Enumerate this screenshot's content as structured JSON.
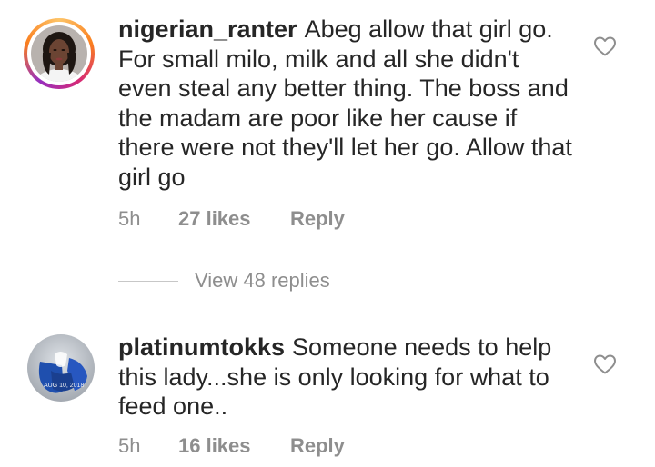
{
  "comments": [
    {
      "username": "nigerian_ranter",
      "text": "Abeg allow that girl go. For small milo, milk and all she didn't even steal any better thing. The boss and the madam are poor like her cause if there were not they'll let her go. Allow that girl go",
      "time": "5h",
      "likes": "27 likes",
      "reply_label": "Reply",
      "avatar_icon": "profile-photo-woman",
      "like_icon": "heart-outline-icon"
    },
    {
      "username": "platinumtokks",
      "text": "Someone needs to help this lady...she is only looking for what to feed one..",
      "time": "5h",
      "likes": "16 likes",
      "reply_label": "Reply",
      "avatar_icon": "profile-photo-blue",
      "avatar_stamp": "AUG 10, 2018",
      "like_icon": "heart-outline-icon"
    }
  ],
  "view_replies": "View 48 replies",
  "colors": {
    "text": "#262626",
    "muted": "#8e8e8e",
    "story_ring": [
      "#fdc468",
      "#fa7e1e",
      "#d62976",
      "#962fbf"
    ]
  }
}
